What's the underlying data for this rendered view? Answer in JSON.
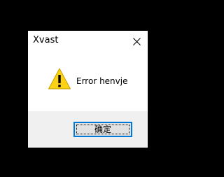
{
  "dialog": {
    "title": "Xvast",
    "message": "Error henvje",
    "ok_label": "确定",
    "close_icon": "close-icon",
    "message_icon": "warning-icon"
  },
  "colors": {
    "backdrop": "#000000",
    "dialog_background": "#ffffff",
    "button_bar_background": "#f0f0f0",
    "button_face": "#e1e1e1",
    "focus_border": "#0078d7",
    "warning_fill": "#fcd116"
  }
}
